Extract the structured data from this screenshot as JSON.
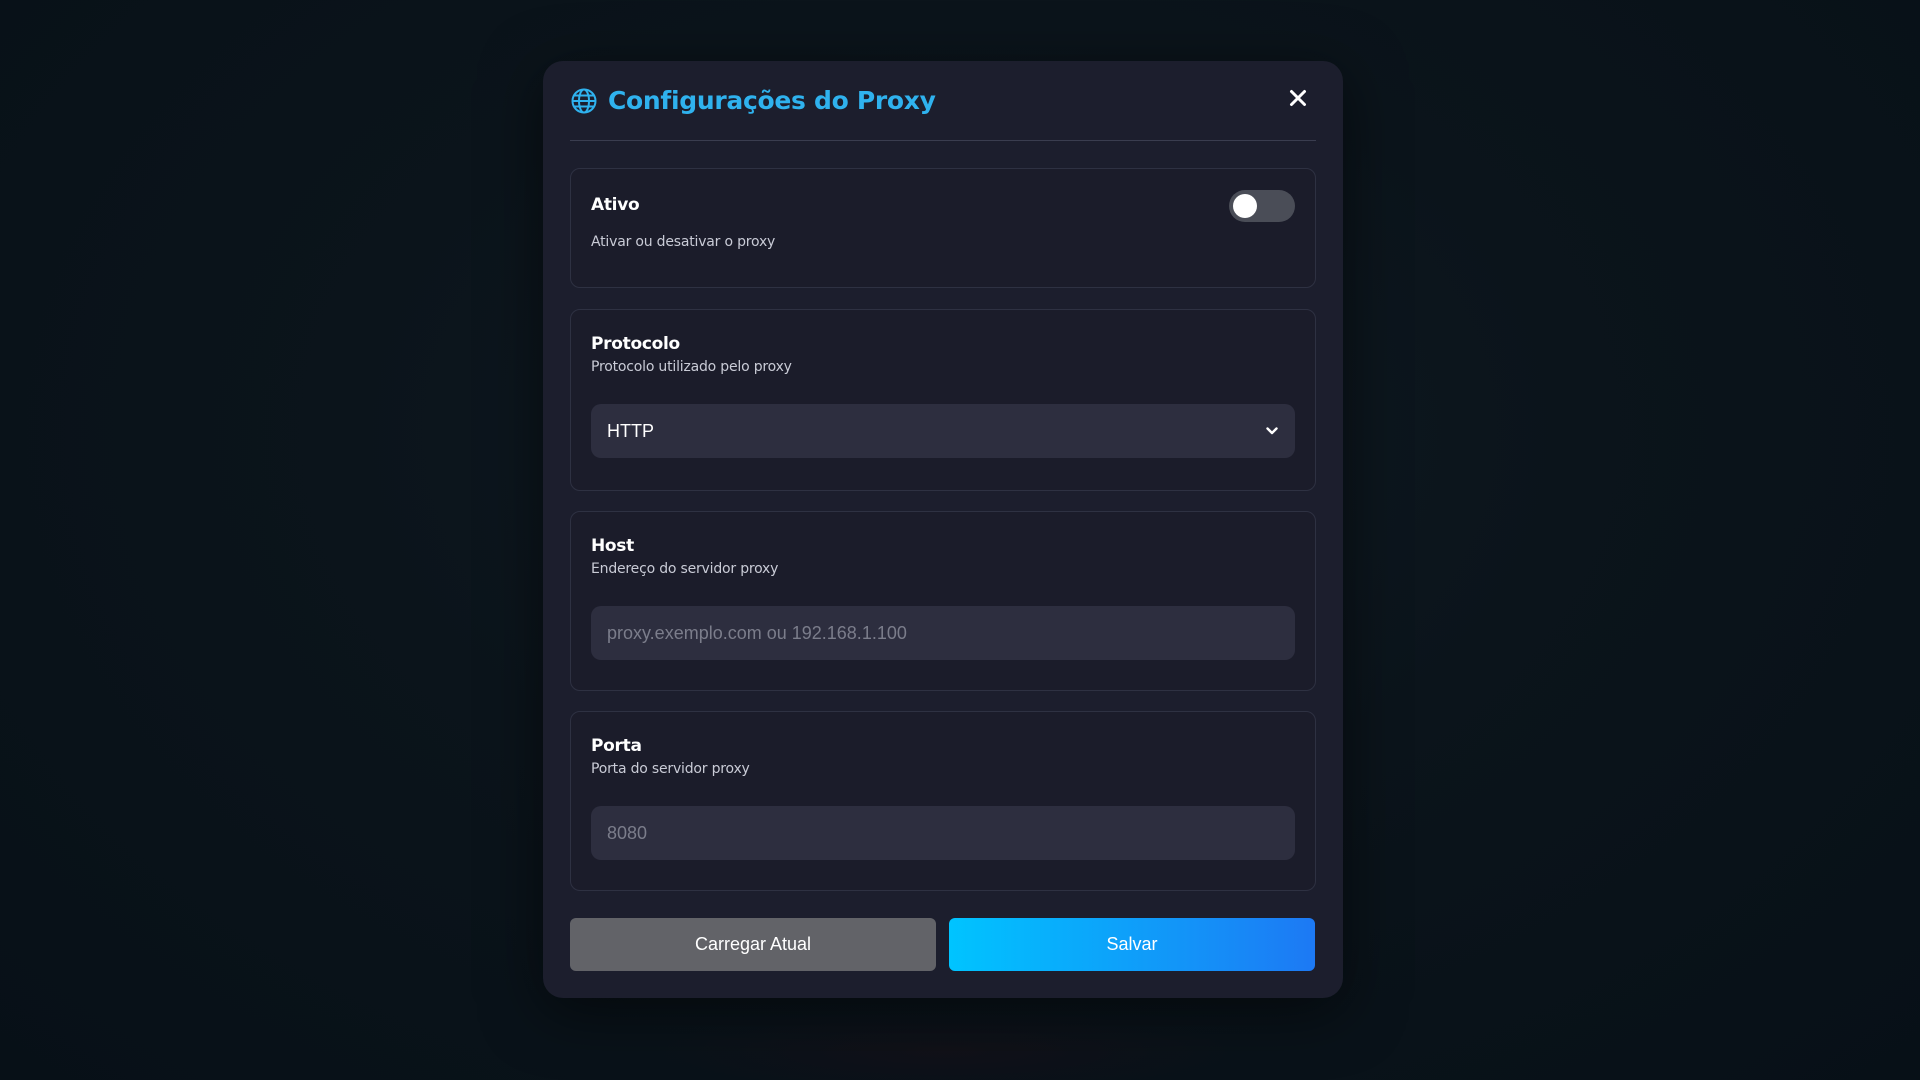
{
  "modal": {
    "title": "Configurações do Proxy",
    "close_label": "×"
  },
  "active": {
    "label": "Ativo",
    "description": "Ativar ou desativar o proxy",
    "enabled": false
  },
  "protocol": {
    "label": "Protocolo",
    "description": "Protocolo utilizado pelo proxy",
    "selected": "HTTP"
  },
  "host": {
    "label": "Host",
    "description": "Endereço do servidor proxy",
    "value": "",
    "placeholder": "proxy.exemplo.com ou 192.168.1.100"
  },
  "port": {
    "label": "Porta",
    "description": "Porta do servidor proxy",
    "value": "",
    "placeholder": "8080"
  },
  "buttons": {
    "load_label": "Carregar Atual",
    "save_label": "Salvar"
  },
  "colors": {
    "accent": "#2fb2ee",
    "save_gradient_start": "#00c4ff",
    "save_gradient_end": "#1d79f4",
    "toggle_off": "#4a4d57"
  },
  "icons": {
    "title_icon": "globe-icon",
    "close_icon": "close-icon",
    "select_icon": "chevron-down-icon"
  }
}
